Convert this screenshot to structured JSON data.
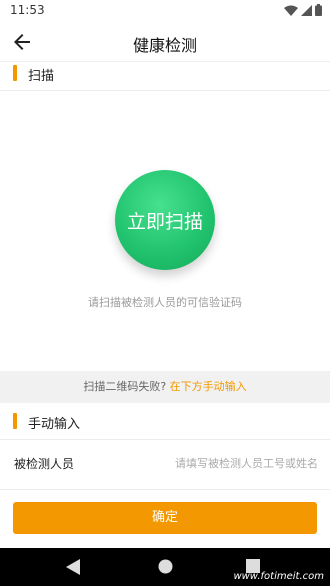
{
  "status_bar": {
    "time": "11:53"
  },
  "header": {
    "title": "健康检测"
  },
  "scan_section": {
    "title": "扫描",
    "button_label": "立即扫描",
    "hint": "请扫描被检测人员的可信验证码"
  },
  "fail_strip": {
    "text": "扫描二维码失败?",
    "link": "在下方手动输入"
  },
  "manual_section": {
    "title": "手动输入",
    "field_label": "被检测人员",
    "field_placeholder": "请填写被检测人员工号或姓名",
    "field_value": ""
  },
  "confirm_label": "确定",
  "watermark": "www.fotimeit.com",
  "colors": {
    "accent": "#f39800",
    "scan_green": "#22c46f"
  }
}
